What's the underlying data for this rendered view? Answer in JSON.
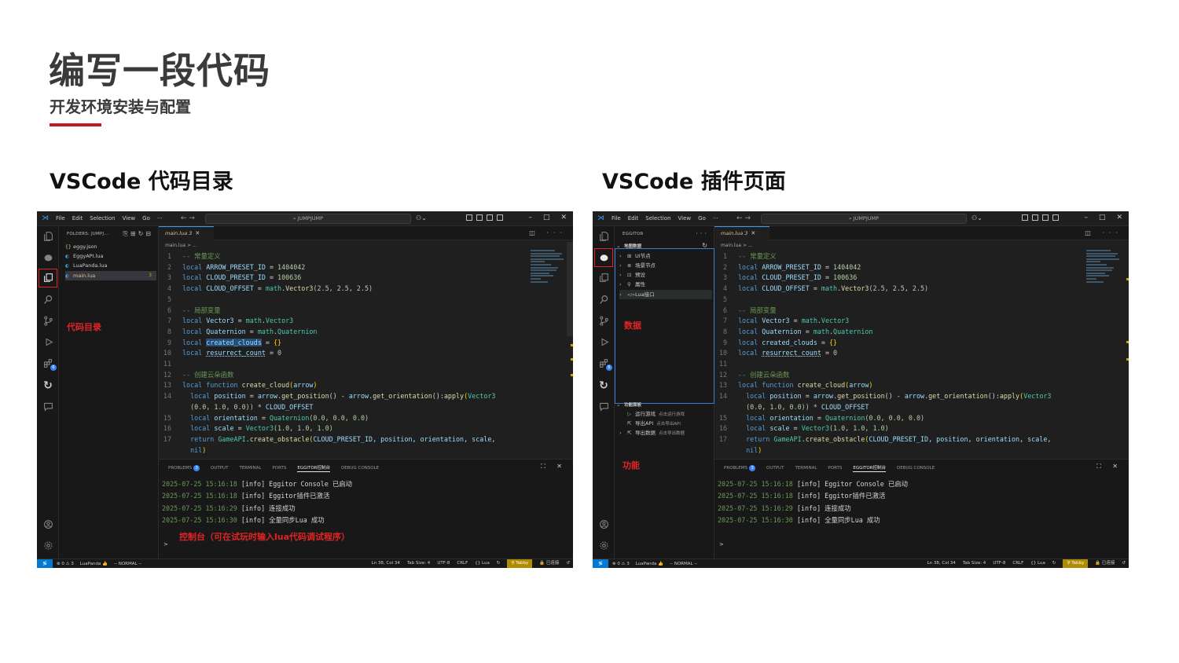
{
  "slide": {
    "title": "编写一段代码",
    "subtitle": "开发环境安装与配置",
    "accent_color": "#c0191f"
  },
  "sections": {
    "left_heading": "VSCode 代码目录",
    "right_heading": "VSCode 插件页面"
  },
  "window": {
    "menus": [
      "File",
      "Edit",
      "Selection",
      "View",
      "Go",
      "···"
    ],
    "search": "⌕ JUMPJUMP",
    "copilot": "⚇⌄",
    "nav": "←  →"
  },
  "explorer": {
    "header": "FOLDERS: JUMPJ...",
    "files": [
      {
        "icon": "{}",
        "name": "eggy.json"
      },
      {
        "icon": "◐",
        "name": "EggyAPI.lua"
      },
      {
        "icon": "◐",
        "name": "LuaPanda.lua"
      },
      {
        "icon": "◐",
        "name": "main.lua",
        "count": "3"
      }
    ],
    "note": "代码目录"
  },
  "eggitor": {
    "header": "EGGITOR",
    "data_section": "地图数据",
    "data_items": [
      {
        "icon": "⊞",
        "label": "UI节点"
      },
      {
        "icon": "⊕",
        "label": "场景节点"
      },
      {
        "icon": "⊡",
        "label": "预设"
      },
      {
        "icon": "⚲",
        "label": "属性"
      },
      {
        "icon": "</>",
        "label": "Lua接口"
      }
    ],
    "func_section": "功能面板",
    "func_items": [
      {
        "icon": "▷",
        "label": "运行游戏",
        "hint": "点击运行游戏"
      },
      {
        "icon": "⇱",
        "label": "导出API",
        "hint": "点击导出API"
      },
      {
        "icon": "⇱",
        "label": "导出数据",
        "hint": "点击导出数据"
      }
    ],
    "note_data": "数据",
    "note_func": "功能"
  },
  "editor": {
    "tab_label": "main.lua 3",
    "breadcrumb": "main.lua > ..."
  },
  "code_lines": [
    "1",
    "2",
    "3",
    "4",
    "5",
    "6",
    "7",
    "8",
    "9",
    "10",
    "11",
    "12",
    "13",
    "14",
    "",
    "15",
    "16",
    "17",
    ""
  ],
  "code": {
    "c1": "-- 常量定义",
    "c2a": "local ",
    "c2b": "ARROW_PRESET_ID",
    "c2c": " = ",
    "c2d": "1404042",
    "c3a": "local ",
    "c3b": "CLOUD_PRESET_ID",
    "c3c": " = ",
    "c3d": "100636",
    "c4a": "local ",
    "c4b": "CLOUD_OFFSET",
    "c4c": " = ",
    "c4d": "math",
    "c4e": ".",
    "c4f": "Vector3",
    "c4g": "(2.5, 2.5, 2.5)",
    "c6": "-- 局部变量",
    "c7a": "local ",
    "c7b": "Vector3",
    "c7c": " = ",
    "c7d": "math",
    "c7e": ".",
    "c7f": "Vector3",
    "c8a": "local ",
    "c8b": "Quaternion",
    "c8c": " = ",
    "c8d": "math",
    "c8e": ".",
    "c8f": "Quaternion",
    "c9a": "local ",
    "c9b": "created_clouds",
    "c9c": " = ",
    "c9d": "{}",
    "c10a": "local ",
    "c10b": "resurrect_count",
    "c10c": " = ",
    "c10d": "0",
    "c12": "-- 创建云朵函数",
    "c13a": "local function ",
    "c13b": "create_cloud",
    "c13c": "(",
    "c13d": "arrow",
    "c13e": ")",
    "c14a": "local ",
    "c14b": "position",
    "c14c": " = ",
    "c14d": "arrow",
    "c14e": ".",
    "c14f": "get_position",
    "c14g": "() - ",
    "c14h": "arrow",
    "c14i": ".",
    "c14j": "get_orientation",
    "c14k": "():",
    "c14l": "apply",
    "c14m": "(",
    "c14n": "Vector3",
    "c14w": "(0.0, 1.0, 0.0)) * ",
    "c14x": "CLOUD_OFFSET",
    "c15a": "local ",
    "c15b": "orientation",
    "c15c": " = ",
    "c15d": "Quaternion",
    "c15e": "(0.0, 0.0, 0.0)",
    "c16a": "local ",
    "c16b": "scale",
    "c16c": " = ",
    "c16d": "Vector3",
    "c16e": "(1.0, 1.0, 1.0)",
    "c17a": "return ",
    "c17b": "GameAPI",
    "c17c": ".",
    "c17d": "create_obstacle",
    "c17e": "(",
    "c17f": "CLOUD_PRESET_ID",
    "c17g": ", ",
    "c17h": "position",
    "c17i": ", ",
    "c17j": "orientation",
    "c17k": ", ",
    "c17l": "scale",
    "c17m": ",",
    "c17w": "nil",
    "c17x": ")"
  },
  "panel": {
    "tabs": [
      "PROBLEMS",
      "OUTPUT",
      "TERMINAL",
      "PORTS",
      "EGGITOR控制台",
      "DEBUG CONSOLE"
    ],
    "problems_badge": "3",
    "logs": [
      {
        "ts": "2025-07-25 15:16:18",
        "tag": "[info]",
        "msg": "Eggitor Console 已启动"
      },
      {
        "ts": "2025-07-25 15:16:18",
        "tag": "[info]",
        "msg": "Eggitor插件已激活"
      },
      {
        "ts": "2025-07-25 15:16:29",
        "tag": "[info]",
        "msg": "连接成功"
      },
      {
        "ts": "2025-07-25 15:16:30",
        "tag": "[info]",
        "msg": "全量同步Lua 成功"
      }
    ],
    "prompt": ">",
    "note": "控制台（可在试玩时输入lua代码调试程序）"
  },
  "statusbar": {
    "remote": "≶",
    "problems": "⊗ 0 ⚠ 3",
    "luapanda": "LuaPanda 👍",
    "mode": "-- NORMAL --",
    "position": "Ln 38, Col 34",
    "tabsize": "Tab Size: 4",
    "encoding": "UTF-8",
    "eol": "CRLF",
    "lang": "{} Lua",
    "tabby": "⚲ Tabby",
    "connected": "🔒 已连接"
  }
}
